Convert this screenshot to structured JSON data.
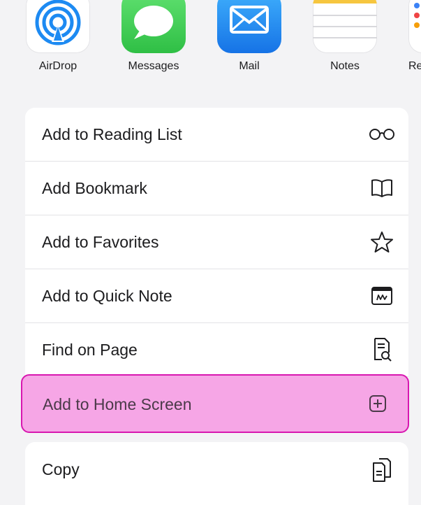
{
  "share_apps": [
    {
      "label": "AirDrop",
      "icon": "airdrop-icon"
    },
    {
      "label": "Messages",
      "icon": "messages-icon"
    },
    {
      "label": "Mail",
      "icon": "mail-icon"
    },
    {
      "label": "Notes",
      "icon": "notes-icon"
    },
    {
      "label": "Re",
      "icon": "reminders-icon"
    }
  ],
  "actions": [
    {
      "label": "Add to Reading List",
      "icon": "glasses-icon"
    },
    {
      "label": "Add Bookmark",
      "icon": "book-icon"
    },
    {
      "label": "Add to Favorites",
      "icon": "star-icon"
    },
    {
      "label": "Add to Quick Note",
      "icon": "quick-note-icon"
    },
    {
      "label": "Find on Page",
      "icon": "find-on-page-icon"
    },
    {
      "label": "Add to Home Screen",
      "icon": "add-square-icon",
      "highlighted": true
    }
  ],
  "copy_action": {
    "label": "Copy",
    "icon": "copy-icon"
  },
  "colors": {
    "highlight_fill": "#f6a6e6",
    "highlight_border": "#d817b0",
    "background": "#f3f3f5"
  }
}
